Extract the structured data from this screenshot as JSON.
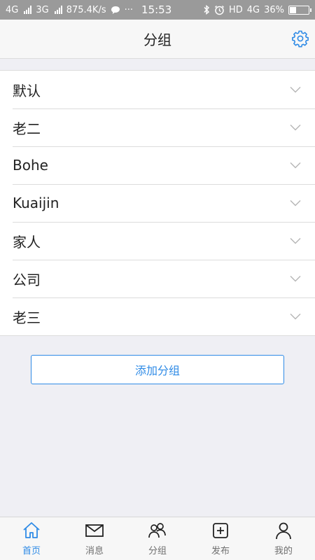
{
  "status_bar": {
    "network1": "4G",
    "network2": "3G",
    "speed": "875.4K/s",
    "dots": "···",
    "time": "15:53",
    "hd": "HD",
    "network3": "4G",
    "battery_level": "36%",
    "battery_percent_value": 36
  },
  "header": {
    "title": "分组"
  },
  "groups": [
    {
      "label": "默认"
    },
    {
      "label": "老二"
    },
    {
      "label": "Bohe"
    },
    {
      "label": "Kuaijin"
    },
    {
      "label": "家人"
    },
    {
      "label": "公司"
    },
    {
      "label": "老三"
    }
  ],
  "add_group_label": "添加分组",
  "bottom_nav": [
    {
      "label": "首页",
      "icon": "home-icon",
      "active": true
    },
    {
      "label": "消息",
      "icon": "mail-icon",
      "active": false
    },
    {
      "label": "分组",
      "icon": "group-icon",
      "active": false
    },
    {
      "label": "发布",
      "icon": "add-box-icon",
      "active": false
    },
    {
      "label": "我的",
      "icon": "user-icon",
      "active": false
    }
  ],
  "colors": {
    "accent": "#2f8be6",
    "background": "#efeff4",
    "status_bar": "#9a9a9a"
  }
}
